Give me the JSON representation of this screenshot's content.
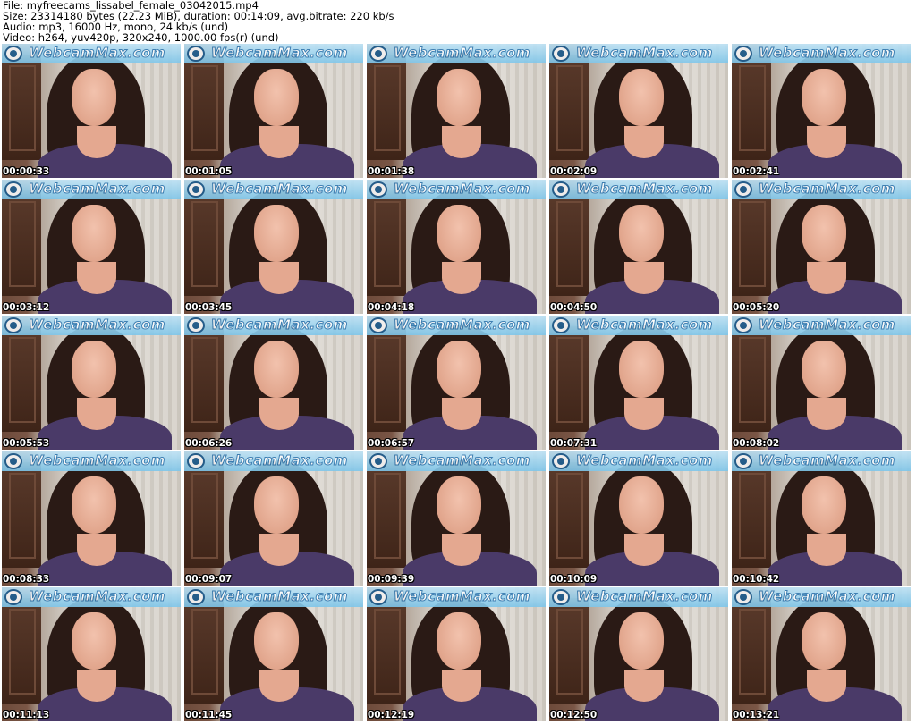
{
  "header": {
    "file": "File: myfreecams_lissabel_female_03042015.mp4",
    "size": "Size: 23314180 bytes (22.23 MiB), duration: 00:14:09, avg.bitrate: 220 kb/s",
    "audio": "Audio: mp3, 16000 Hz, mono, 24 kb/s (und)",
    "video": "Video: h264, yuv420p, 320x240, 1000.00 fps(r) (und)"
  },
  "watermark": "WebcamMax.com",
  "frames": [
    {
      "time": "00:00:33"
    },
    {
      "time": "00:01:05"
    },
    {
      "time": "00:01:38"
    },
    {
      "time": "00:02:09"
    },
    {
      "time": "00:02:41"
    },
    {
      "time": "00:03:12"
    },
    {
      "time": "00:03:45"
    },
    {
      "time": "00:04:18"
    },
    {
      "time": "00:04:50"
    },
    {
      "time": "00:05:20"
    },
    {
      "time": "00:05:53"
    },
    {
      "time": "00:06:26"
    },
    {
      "time": "00:06:57"
    },
    {
      "time": "00:07:31"
    },
    {
      "time": "00:08:02"
    },
    {
      "time": "00:08:33"
    },
    {
      "time": "00:09:07"
    },
    {
      "time": "00:09:39"
    },
    {
      "time": "00:10:09"
    },
    {
      "time": "00:10:42"
    },
    {
      "time": "00:11:13"
    },
    {
      "time": "00:11:45"
    },
    {
      "time": "00:12:19"
    },
    {
      "time": "00:12:50"
    },
    {
      "time": "00:13:21"
    }
  ]
}
